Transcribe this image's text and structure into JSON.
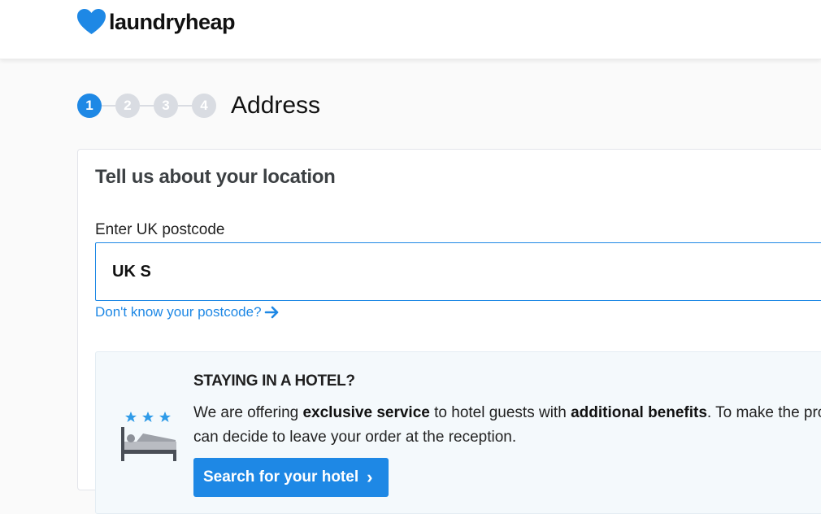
{
  "header": {
    "logo_text": "laundryheap"
  },
  "stepper": {
    "steps": [
      "1",
      "2",
      "3",
      "4"
    ],
    "active_step": 1,
    "title": "Address"
  },
  "location_card": {
    "title": "Tell us about your location",
    "postcode_label": "Enter UK postcode",
    "postcode_value": "UK S",
    "postcode_help_link": "Don't know your postcode?"
  },
  "hotel": {
    "heading": "STAYING IN A HOTEL?",
    "text_1": "We are offering ",
    "text_bold_1": "exclusive service",
    "text_2": " to hotel guests with ",
    "text_bold_2": "additional benefits",
    "text_3": ". To make the pro",
    "text_4": "can decide to leave your order at the reception.",
    "button_label": "Search for your hotel"
  },
  "colors": {
    "accent": "#1e88e5",
    "step_inactive": "#d9dce2",
    "hotel_box_bg": "#f4f9fc"
  }
}
